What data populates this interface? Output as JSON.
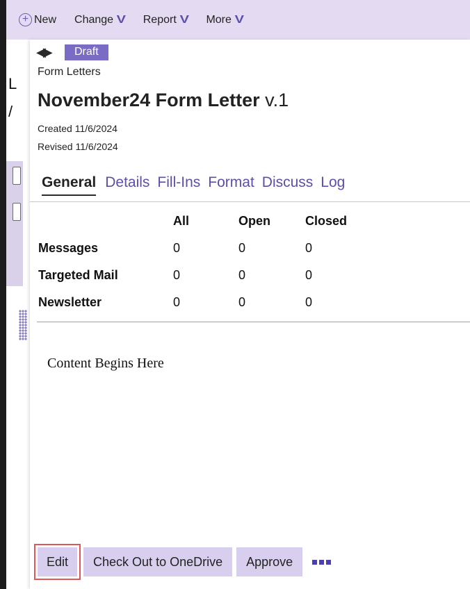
{
  "menubar": {
    "items": [
      {
        "label": "New",
        "icon": "plus-circle-icon"
      },
      {
        "label": "Change",
        "icon": "chevron-down-icon"
      },
      {
        "label": "Report",
        "icon": "chevron-down-icon"
      },
      {
        "label": "More",
        "icon": "chevron-down-icon"
      }
    ]
  },
  "header": {
    "status": "Draft",
    "category": "Form Letters",
    "title": "November24 Form Letter",
    "version": "v.1",
    "created": "Created 11/6/2024",
    "revised": "Revised 11/6/2024"
  },
  "tabs": [
    "General",
    "Details",
    "Fill-Ins",
    "Format",
    "Discuss",
    "Log"
  ],
  "active_tab": "General",
  "stats": {
    "columns": [
      "All",
      "Open",
      "Closed"
    ],
    "rows": [
      {
        "label": "Messages",
        "values": [
          "0",
          "0",
          "0"
        ]
      },
      {
        "label": "Targeted Mail",
        "values": [
          "0",
          "0",
          "0"
        ]
      },
      {
        "label": "Newsletter",
        "values": [
          "0",
          "0",
          "0"
        ]
      }
    ]
  },
  "content": "Content Begins Here",
  "actions": {
    "edit": "Edit",
    "checkout": "Check Out to OneDrive",
    "approve": "Approve"
  },
  "colors": {
    "accent": "#7a6bc4",
    "menubar_bg": "#e4dbf2",
    "button_bg": "#d8cfee",
    "highlight": "#e05555"
  }
}
